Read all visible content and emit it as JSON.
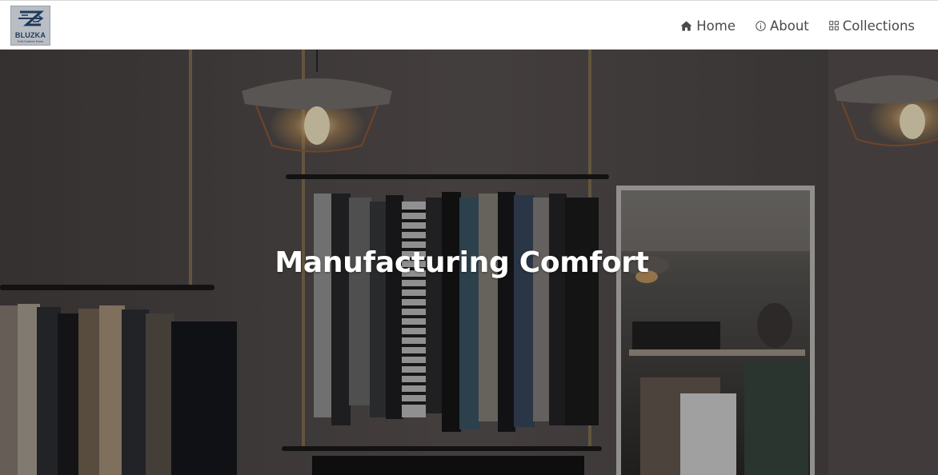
{
  "brand": {
    "name": "BLUZKA",
    "tagline": "Knit Custom Kaos",
    "color": "#1f3a5a"
  },
  "nav": {
    "items": [
      {
        "label": "Home",
        "icon": "home-icon"
      },
      {
        "label": "About",
        "icon": "info-icon"
      },
      {
        "label": "Collections",
        "icon": "grid-icon"
      }
    ]
  },
  "hero": {
    "title": "Manufacturing Comfort",
    "background": "clothing-store-photo"
  },
  "colors": {
    "nav_text": "#4a4a4a",
    "hero_text": "#ffffff"
  }
}
